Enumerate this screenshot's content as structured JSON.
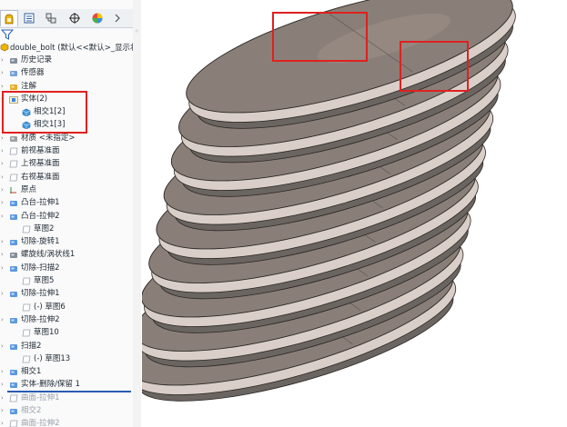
{
  "feature_tree": {
    "root_label": "double_bolt (默认<<默认>_显示状态",
    "items": [
      {
        "label": "历史记录",
        "indent": 0,
        "icon": "history-icon"
      },
      {
        "label": "传感器",
        "indent": 0,
        "icon": "sensor-icon"
      },
      {
        "label": "注解",
        "indent": 0,
        "icon": "annotation-icon"
      },
      {
        "label": "实体(2)",
        "indent": 0,
        "icon": "solid-bodies-folder-icon"
      },
      {
        "label": "相交1[2]",
        "indent": 1,
        "icon": "solid-body-icon"
      },
      {
        "label": "相交1[3]",
        "indent": 1,
        "icon": "solid-body-icon"
      },
      {
        "label": "材质 <未指定>",
        "indent": 0,
        "icon": "material-icon"
      },
      {
        "label": "前视基准面",
        "indent": 0,
        "icon": "plane-icon"
      },
      {
        "label": "上视基准面",
        "indent": 0,
        "icon": "plane-icon"
      },
      {
        "label": "右视基准面",
        "indent": 0,
        "icon": "plane-icon"
      },
      {
        "label": "原点",
        "indent": 0,
        "icon": "origin-icon"
      },
      {
        "label": "凸台-拉伸1",
        "indent": 0,
        "icon": "extrude-icon"
      },
      {
        "label": "凸台-拉伸2",
        "indent": 0,
        "icon": "extrude-icon"
      },
      {
        "label": "草图2",
        "indent": 1,
        "icon": "sketch-icon"
      },
      {
        "label": "切除-旋转1",
        "indent": 0,
        "icon": "revolve-cut-icon"
      },
      {
        "label": "螺旋线/涡状线1",
        "indent": 0,
        "icon": "helix-icon"
      },
      {
        "label": "切除-扫描2",
        "indent": 0,
        "icon": "sweep-cut-icon"
      },
      {
        "label": "草图5",
        "indent": 1,
        "icon": "sketch-icon"
      },
      {
        "label": "切除-拉伸1",
        "indent": 0,
        "icon": "extrude-cut-icon"
      },
      {
        "label": "(-) 草图6",
        "indent": 1,
        "icon": "sketch-icon"
      },
      {
        "label": "切除-拉伸2",
        "indent": 0,
        "icon": "extrude-cut-icon"
      },
      {
        "label": "草图10",
        "indent": 1,
        "icon": "sketch-icon"
      },
      {
        "label": "扫描2",
        "indent": 0,
        "icon": "sweep-icon"
      },
      {
        "label": "(-) 草图13",
        "indent": 1,
        "icon": "sketch-icon"
      },
      {
        "label": "相交1",
        "indent": 0,
        "icon": "intersect-icon"
      },
      {
        "label": "实体-删除/保留 1",
        "indent": 0,
        "icon": "body-delete-icon"
      },
      {
        "label": "曲面-拉伸1",
        "indent": 0,
        "icon": "surface-extrude-icon",
        "dim": true
      },
      {
        "label": "相交2",
        "indent": 0,
        "icon": "intersect-icon",
        "dim": true
      },
      {
        "label": "曲面-拉伸2",
        "indent": 0,
        "icon": "surface-extrude-icon",
        "dim": true
      }
    ]
  },
  "tabs": [
    "feature-manager-tab",
    "property-manager-tab",
    "configuration-manager-tab",
    "dimxpert-tab",
    "display-manager-tab"
  ],
  "colors": {
    "highlight": "#e02020",
    "thread_dark": "#6b6561",
    "thread_light": "#8a7f78",
    "thread_face": "#d9cfc8"
  }
}
